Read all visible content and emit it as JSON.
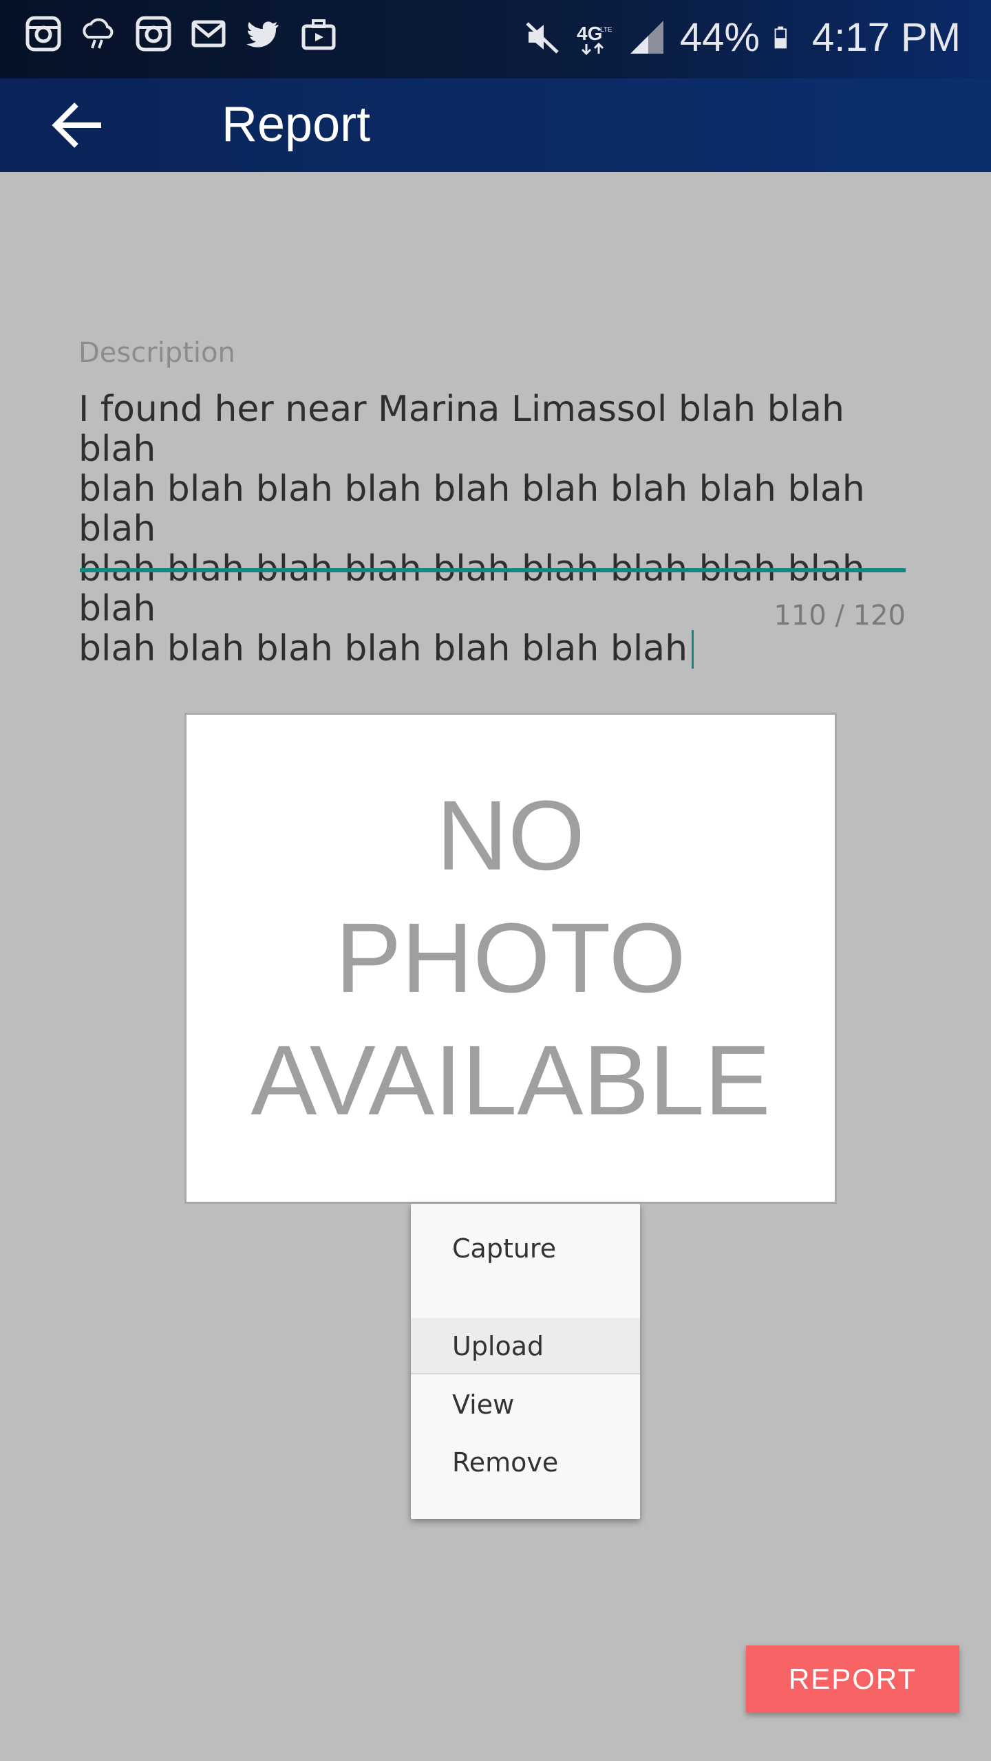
{
  "status_bar": {
    "left_icons": [
      "instagram-icon",
      "cloud-rain-icon",
      "instagram-icon",
      "mail-icon",
      "twitter-icon",
      "briefcase-icon"
    ],
    "network": "4G LTE",
    "battery_percent": "44%",
    "time": "4:17 PM"
  },
  "app_bar": {
    "title": "Report"
  },
  "description": {
    "label": "Description",
    "value": "I found her near Marina Limassol blah blah blah blah blah blah blah blah blah blah blah blah blah blah blah blah blah blah blah blah blah blah blah blah blah blah blah blah blah blah",
    "counter": "110 / 120",
    "lines": [
      "I found her near Marina Limassol blah blah blah",
      "blah blah blah blah blah blah blah blah blah blah",
      "blah blah blah blah blah blah blah blah blah blah",
      "blah blah blah blah blah blah blah"
    ]
  },
  "photo": {
    "placeholder_lines": [
      "NO",
      "PHOTO",
      "AVAILABLE"
    ]
  },
  "menu": {
    "items": [
      "Capture",
      "Upload",
      "View",
      "Remove"
    ]
  },
  "actions": {
    "report_label": "REPORT"
  },
  "colors": {
    "accent_underline": "#12897f",
    "report_button": "#f76364",
    "app_bar": "#0b2a63"
  }
}
